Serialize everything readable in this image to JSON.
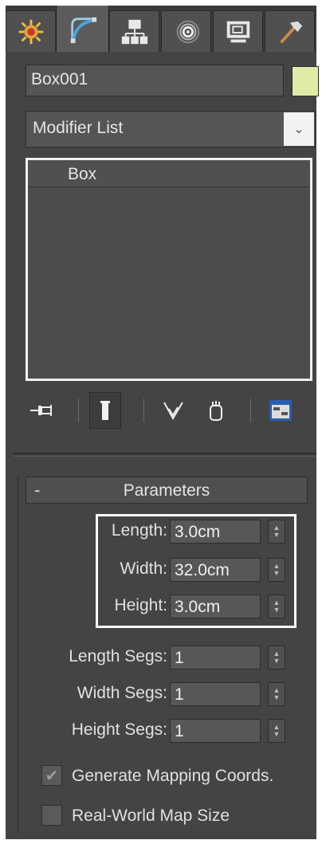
{
  "tabs": [
    {
      "name": "create-tab-icon"
    },
    {
      "name": "modify-tab-icon"
    },
    {
      "name": "hierarchy-tab-icon"
    },
    {
      "name": "motion-tab-icon"
    },
    {
      "name": "display-tab-icon"
    },
    {
      "name": "utilities-tab-icon"
    }
  ],
  "object": {
    "name": "Box001",
    "color": "#dfeba6"
  },
  "modifier_list": {
    "label": "Modifier List"
  },
  "stack": {
    "items": [
      "Box"
    ]
  },
  "parameters": {
    "title": "Parameters",
    "collapse_symbol": "-",
    "length": {
      "label": "Length:",
      "value": "3.0cm"
    },
    "width": {
      "label": "Width:",
      "value": "32.0cm"
    },
    "height": {
      "label": "Height:",
      "value": "3.0cm"
    },
    "length_segs": {
      "label": "Length Segs:",
      "value": "1"
    },
    "width_segs": {
      "label": "Width Segs:",
      "value": "1"
    },
    "height_segs": {
      "label": "Height Segs:",
      "value": "1"
    },
    "generate_mapping": {
      "label": "Generate Mapping Coords.",
      "checked": true
    },
    "real_world": {
      "label": "Real-World Map Size",
      "checked": false
    }
  }
}
